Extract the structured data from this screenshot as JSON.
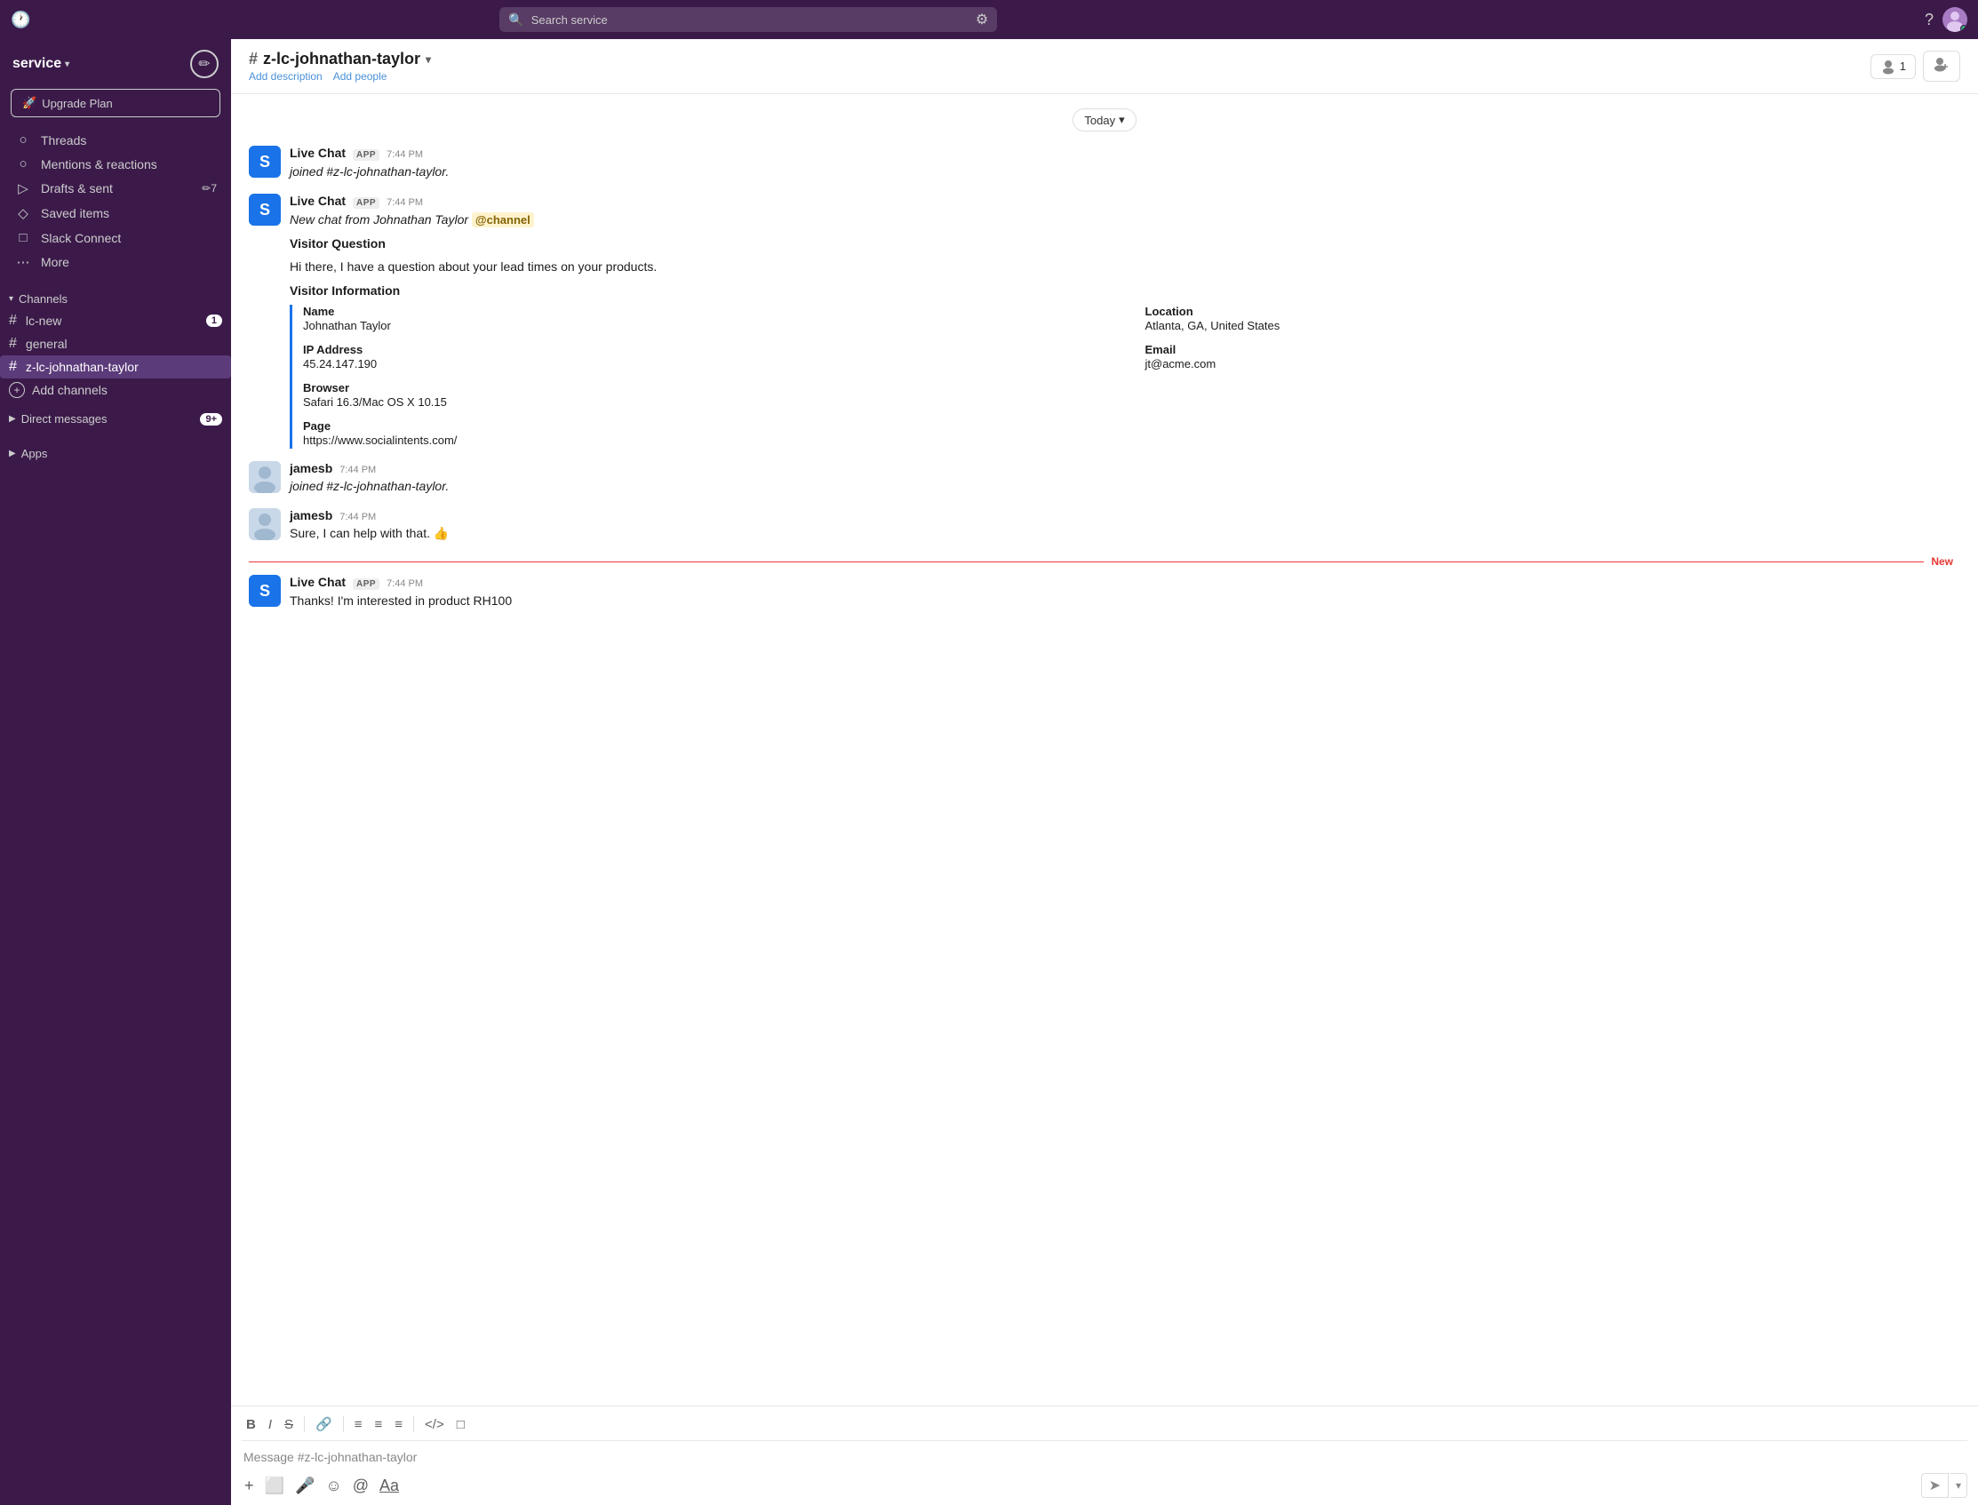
{
  "topbar": {
    "search_placeholder": "Search service",
    "history_icon": "🕐",
    "help_icon": "?",
    "filter_icon": "⚙"
  },
  "sidebar": {
    "workspace_name": "service",
    "compose_icon": "✏",
    "upgrade_btn": "Upgrade Plan",
    "nav_items": [
      {
        "id": "threads",
        "icon": "○",
        "label": "Threads"
      },
      {
        "id": "mentions",
        "icon": "○",
        "label": "Mentions & reactions"
      },
      {
        "id": "drafts",
        "icon": "▷",
        "label": "Drafts & sent",
        "badge": "7"
      },
      {
        "id": "saved",
        "icon": "◇",
        "label": "Saved items"
      },
      {
        "id": "connect",
        "icon": "□",
        "label": "Slack Connect"
      },
      {
        "id": "more",
        "icon": "⋯",
        "label": "More"
      }
    ],
    "channels_label": "Channels",
    "channels": [
      {
        "id": "lc-new",
        "name": "lc-new",
        "badge": "1"
      },
      {
        "id": "general",
        "name": "general",
        "badge": ""
      },
      {
        "id": "z-lc-johnathan-taylor",
        "name": "z-lc-johnathan-taylor",
        "badge": "",
        "active": true
      }
    ],
    "add_channels_label": "Add channels",
    "dm_label": "Direct messages",
    "dm_badge": "9+",
    "apps_label": "Apps"
  },
  "channel": {
    "name": "z-lc-johnathan-taylor",
    "add_description": "Add description",
    "add_people": "Add people",
    "member_count": "1"
  },
  "messages": {
    "date_label": "Today",
    "items": [
      {
        "id": "msg1",
        "sender": "Live Chat",
        "is_app": true,
        "app_label": "APP",
        "time": "7:44 PM",
        "avatar_type": "livechat",
        "avatar_letter": "S",
        "text": "joined #z-lc-johnathan-taylor.",
        "italic": true
      },
      {
        "id": "msg2",
        "sender": "Live Chat",
        "is_app": true,
        "app_label": "APP",
        "time": "7:44 PM",
        "avatar_type": "livechat",
        "avatar_letter": "S",
        "text_parts": [
          {
            "type": "italic",
            "content": "New chat from Johnathan Taylor "
          },
          {
            "type": "mention",
            "content": "@channel"
          }
        ],
        "visitor_info": {
          "title": "Visitor Question",
          "question": "Hi there, I have a question about your lead times on your products.",
          "fields": [
            {
              "label": "Name",
              "value": "Johnathan Taylor"
            },
            {
              "label": "Location",
              "value": "Atlanta, GA, United States"
            },
            {
              "label": "IP Address",
              "value": "45.24.147.190"
            },
            {
              "label": "Email",
              "value": "jt@acme.com"
            },
            {
              "label": "Browser",
              "value": "Safari 16.3/Mac OS X 10.15"
            },
            {
              "label": "Page",
              "value": "https://www.socialintents.com/"
            }
          ]
        }
      },
      {
        "id": "msg3",
        "sender": "jamesb",
        "is_app": false,
        "time": "7:44 PM",
        "avatar_type": "user",
        "text": "joined #z-lc-johnathan-taylor.",
        "italic": true
      },
      {
        "id": "msg4",
        "sender": "jamesb",
        "is_app": false,
        "time": "7:44 PM",
        "avatar_type": "user",
        "text": "Sure, I can help with that. 👍"
      },
      {
        "id": "msg5",
        "sender": "Live Chat",
        "is_app": true,
        "app_label": "APP",
        "time": "7:44 PM",
        "avatar_type": "livechat",
        "avatar_letter": "S",
        "text": "Thanks!  I'm interested in product RH100",
        "is_new": true
      }
    ],
    "new_label": "New",
    "input_placeholder": "Message #z-lc-johnathan-taylor"
  },
  "toolbar": {
    "bold": "B",
    "italic": "I",
    "strike": "S",
    "link": "🔗",
    "ol": "≡",
    "ul": "≡",
    "indent": "≡",
    "code": "</>",
    "block": "□"
  }
}
